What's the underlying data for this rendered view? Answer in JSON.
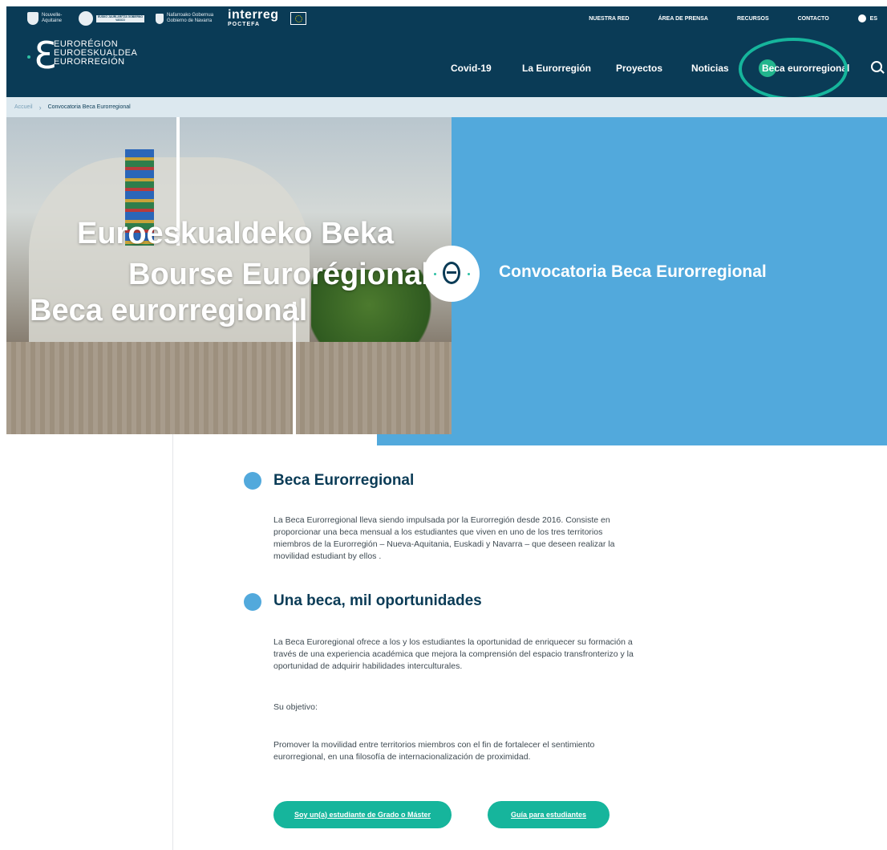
{
  "header": {
    "partners": {
      "aquitaine": "Nouvelle-Aquitaine",
      "basque": "EUSKO JAURLARITZA GOBIERNO VASCO",
      "navarra": "Nafarroako Gobernua Gobierno de Navarra",
      "interreg": "interreg",
      "interreg_sub": "POCTEFA"
    },
    "top_links": [
      "NUESTRA RED",
      "ÁREA DE PRENSA",
      "RECURSOS",
      "CONTACTO"
    ],
    "language": "ES",
    "brand": {
      "line1": "EURORÉGION",
      "line2": "EUROESKUALDEA",
      "line3": "EURORREGIÓN"
    },
    "nav": {
      "covid": "Covid-19",
      "euroregion": "La Eurorregión",
      "proyectos": "Proyectos",
      "noticias": "Noticias",
      "beca": "Beca eurorregional"
    },
    "accent": "#16b59c",
    "navy": "#0a3b56"
  },
  "breadcrumb": {
    "home": "Accueil",
    "current": "Convocatoria Beca Eurorregional"
  },
  "hero": {
    "line1": "Euroeskualdeko Beka",
    "line2": "Bourse Eurorégionale",
    "line3": "Beca eurorregional",
    "title": "Convocatoria Beca Eurorregional",
    "blue": "#52a9dc"
  },
  "content": {
    "section1_title": "Beca Eurorregional",
    "section1_text": "La Beca Eurorregional lleva siendo impulsada por la Eurorregión desde 2016. Consiste en proporcionar una beca mensual a los estudiantes que viven en uno de los tres territorios miembros de la Eurorregión – Nueva-Aquitania, Euskadi y Navarra – que deseen realizar la movilidad estudiant by ellos .",
    "section2_title": "Una beca, mil oportunidades",
    "section2_text": "La Beca Euroregional ofrece a los y los estudiantes la oportunidad de enriquecer su formación a través de una experiencia académica que mejora la comprensión del espacio transfronterizo y la oportunidad de adquirir habilidades interculturales.",
    "objective_label": "Su objetivo:",
    "objective_text": "Promover la movilidad entre territorios miembros con el fin de fortalecer el sentimiento eurorregional, en una filosofía de internacionalización de proximidad."
  },
  "buttons": {
    "student": "Soy un(a) estudiante de Grado o Máster",
    "guide": "Guía para estudiantes"
  }
}
